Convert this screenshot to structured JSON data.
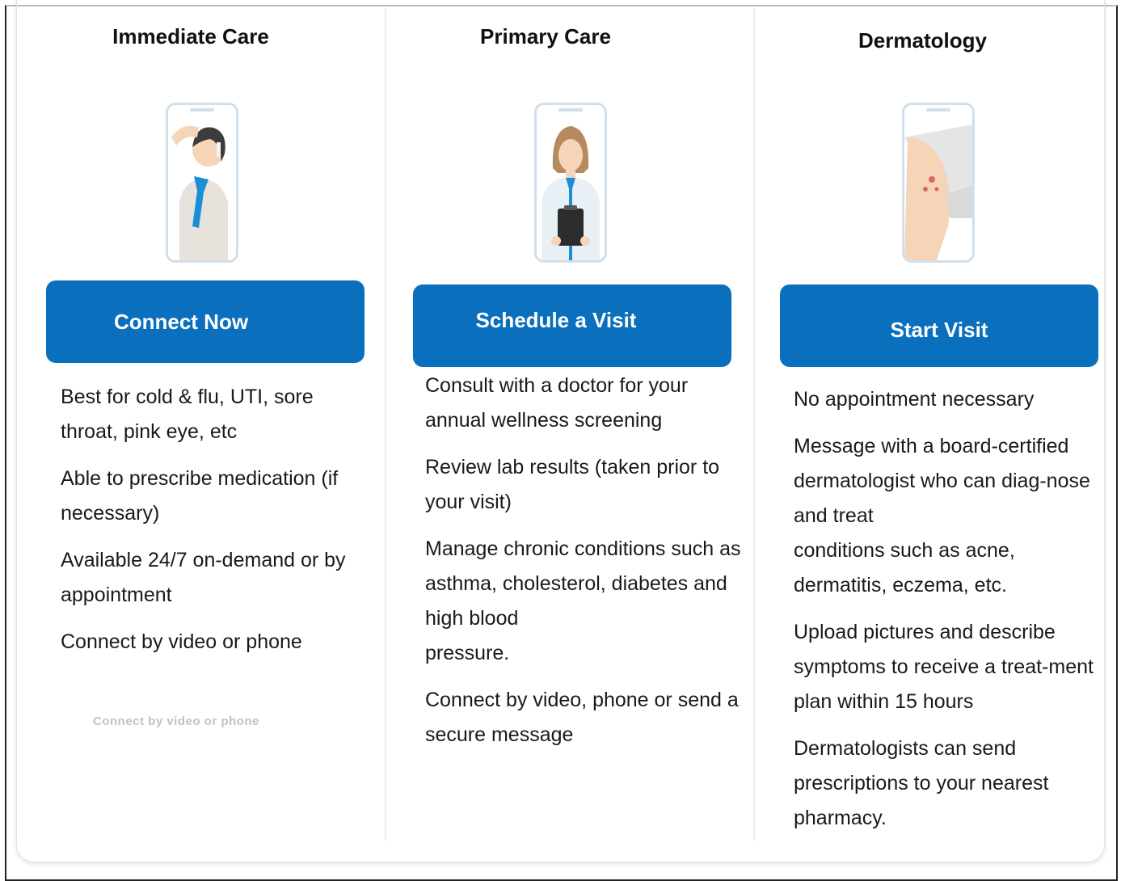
{
  "columns": [
    {
      "title": "Immediate Care",
      "image": "person-with-fever-icon",
      "button_label": "Connect Now",
      "features": [
        "Best for cold & flu, UTI, sore throat, pink eye, etc",
        "Able to prescribe medication (if necessary)",
        "Available 24/7 on-demand or by appointment",
        "Connect by video or phone"
      ],
      "ghost_text": "Connect by video or phone"
    },
    {
      "title": "Primary Care",
      "image": "doctor-with-clipboard-icon",
      "button_label": "Schedule a Visit",
      "features": [
        "Consult with a doctor for your annual wellness screening",
        "Review lab results (taken prior to your visit)",
        "Manage chronic conditions such as asthma, cholesterol, diabetes and high blood\npressure.",
        "Connect by video, phone or send a secure message"
      ]
    },
    {
      "title": "Dermatology",
      "image": "skin-rash-arm-icon",
      "button_label": "Start Visit",
      "features": [
        "No appointment necessary",
        "Message with a board-certified dermatologist who can diag-nose and treat\nconditions such as acne, dermatitis, eczema, etc.",
        "Upload pictures and describe symptoms to receive a treat-ment plan within 15 hours",
        "Dermatologists can send prescriptions to your nearest pharmacy."
      ]
    }
  ],
  "colors": {
    "button": "#0a6fbd",
    "phone_frame": "#cfdfec",
    "scarf": "#1b8fd6",
    "skin": "#f6d4b8"
  }
}
